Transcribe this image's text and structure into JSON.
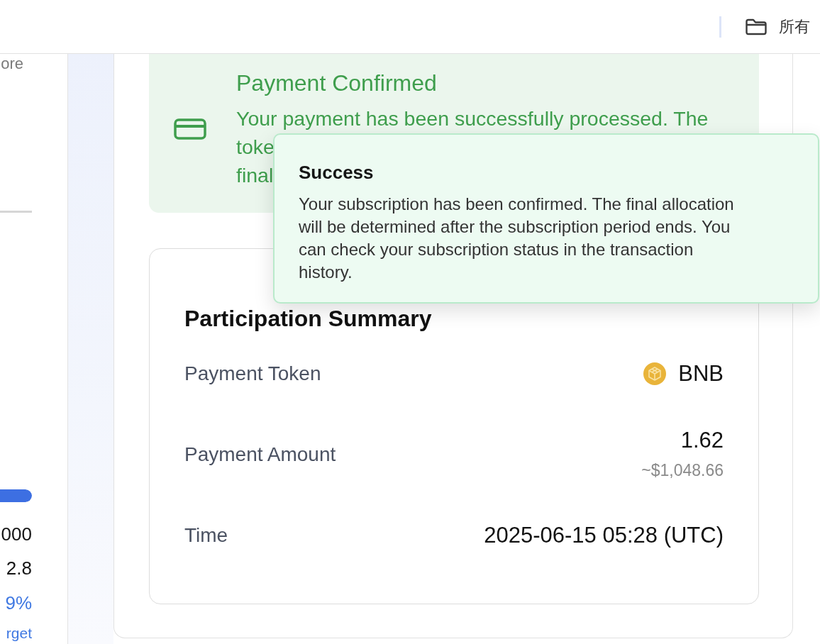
{
  "header": {
    "folder_label": "所有"
  },
  "side_panel": {
    "note": "ore",
    "progress": {
      "level": 1
    },
    "stats": [
      {
        "text": "000",
        "kind": "value"
      },
      {
        "text": "2.8",
        "kind": "value"
      },
      {
        "text": "9%",
        "kind": "percent"
      },
      {
        "text": "rget",
        "kind": "caption"
      }
    ]
  },
  "payment_alert": {
    "title": "Payment Confirmed",
    "lines": [
      "Your payment has been successfully processed. The",
      "toke",
      "final"
    ]
  },
  "toast": {
    "title": "Success",
    "message": "Your subscription has been confirmed. The final allocation will be determined after the subscription period ends. You can check your subscription status in the transaction history."
  },
  "summary": {
    "title": "Participation Summary",
    "rows": [
      {
        "label": "Payment Token",
        "kind": "token",
        "value": "BNB"
      },
      {
        "label": "Payment Amount",
        "kind": "amount",
        "value": "1.62",
        "sub_value": "~$1,048.66"
      },
      {
        "label": "Time",
        "kind": "text",
        "value": "2025-06-15 05:28 (UTC)"
      }
    ]
  }
}
